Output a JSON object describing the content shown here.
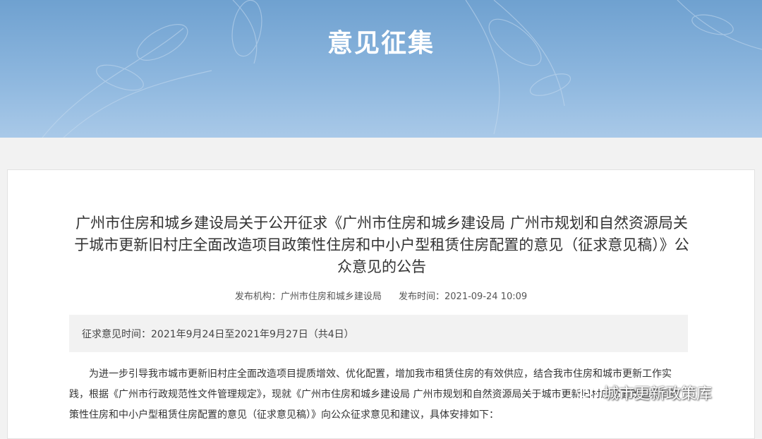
{
  "banner": {
    "title": "意见征集"
  },
  "article": {
    "title": "广州市住房和城乡建设局关于公开征求《广州市住房和城乡建设局 广州市规划和自然资源局关于城市更新旧村庄全面改造项目政策性住房和中小户型租赁住房配置的意见（征求意见稿）》公众意见的公告",
    "publisher": "发布机构：广州市住房和城乡建设局",
    "publish_time": "发布时间：2021-09-24 10:09",
    "comment_period": "征求意见时间：2021年9月24日至2021年9月27日（共4日）",
    "body": "为进一步引导我市城市更新旧村庄全面改造项目提质增效、优化配置，增加我市租赁住房的有效供应，结合我市住房和城市更新工作实践，根据《广州市行政规范性文件管理规定》，现就《广州市住房和城乡建设局 广州市规划和自然资源局关于城市更新旧村庄全面改造项目政策性住房和中小户型租赁住房配置的意见（征求意见稿）》向公众征求意见和建议，具体安排如下："
  },
  "watermark": {
    "text": "城市更新政策库",
    "icon": "wechat-icon"
  }
}
